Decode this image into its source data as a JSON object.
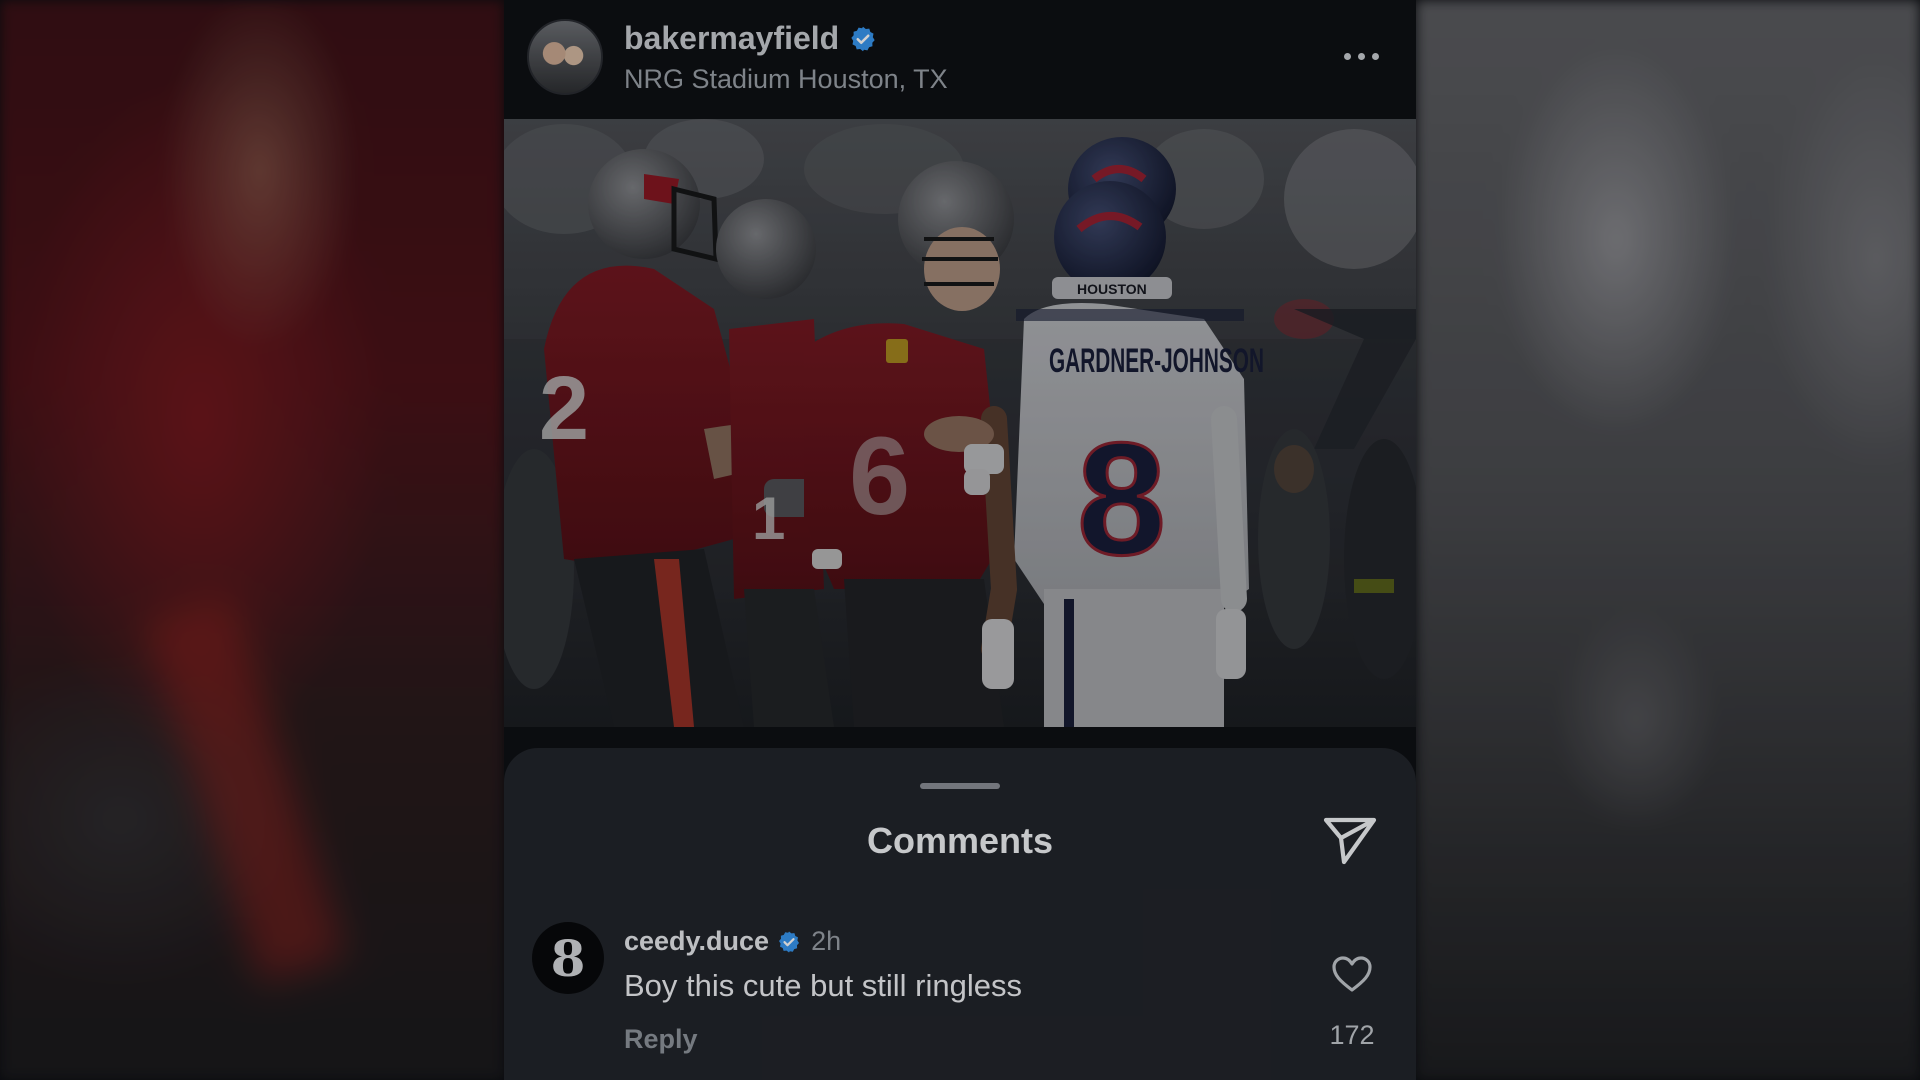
{
  "post": {
    "username": "bakermayfield",
    "location": "NRG Stadium Houston, TX",
    "image_jersey_name": "GARDNER-JOHNSON",
    "image_jersey_number": "8",
    "image_helmet_text": "HOUSTON"
  },
  "comments_sheet": {
    "title": "Comments"
  },
  "comment": {
    "username": "ceedy.duce",
    "time": "2h",
    "text": "Boy this cute but still ringless",
    "reply_label": "Reply",
    "like_count": "172",
    "avatar_glyph": "8"
  },
  "colors": {
    "verified_badge": "#3897f0",
    "buccaneers_red": "#8e1b26",
    "texans_white": "#d9dbe0",
    "sheet_bg": "#22252b"
  }
}
